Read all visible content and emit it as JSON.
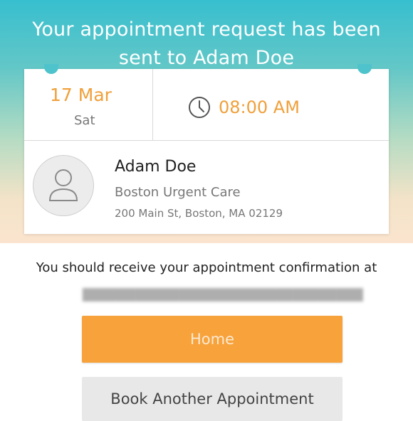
{
  "header": {
    "title_line1": "Your appointment request has been",
    "title_line2": "sent to Adam Doe"
  },
  "appointment": {
    "date": "17 Mar",
    "weekday": "Sat",
    "time": "08:00 AM",
    "time_icon": "clock-icon"
  },
  "provider": {
    "avatar_icon": "user-icon",
    "name": "Adam Doe",
    "clinic": "Boston Urgent Care",
    "address": "200 Main St, Boston, MA 02129"
  },
  "confirmation": {
    "message": "You should receive your appointment confirmation at"
  },
  "actions": {
    "home_label": "Home",
    "book_label": "Book Another Appointment"
  },
  "colors": {
    "accent": "#f7a23a",
    "date_text": "#f0a03a",
    "header_top": "#37bfcf",
    "header_bottom": "#fbe4cf"
  }
}
